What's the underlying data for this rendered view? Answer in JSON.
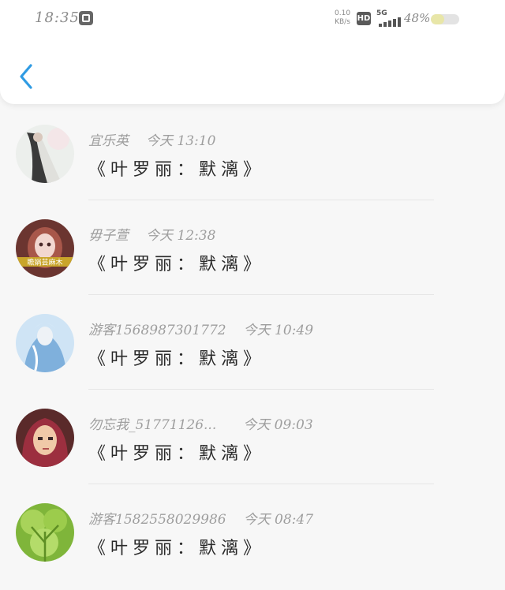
{
  "status_bar": {
    "time": "18:35",
    "net_speed_value": "0.10",
    "net_speed_unit": "KB/s",
    "hd_label": "HD",
    "network": "5G",
    "battery_percent": "48%",
    "battery_level": 0.48
  },
  "header": {
    "back_icon": "chevron-left-icon"
  },
  "items": [
    {
      "user": "宜乐英",
      "time": "今天 13:10",
      "title": "《叶罗丽：默漓》",
      "avatar_badge": ""
    },
    {
      "user": "毋子萱",
      "time": "今天 12:38",
      "title": "《叶罗丽：默漓》",
      "avatar_badge": "瞻娲芸麻木"
    },
    {
      "user": "游客1568987301772",
      "time": "今天 10:49",
      "title": "《叶罗丽：默漓》",
      "avatar_badge": ""
    },
    {
      "user": "勿忘我_51771126...",
      "time": "今天 09:03",
      "title": "《叶罗丽：默漓》",
      "avatar_badge": ""
    },
    {
      "user": "游客1582558029986",
      "time": "今天 08:47",
      "title": "《叶罗丽：默漓》",
      "avatar_badge": ""
    }
  ]
}
